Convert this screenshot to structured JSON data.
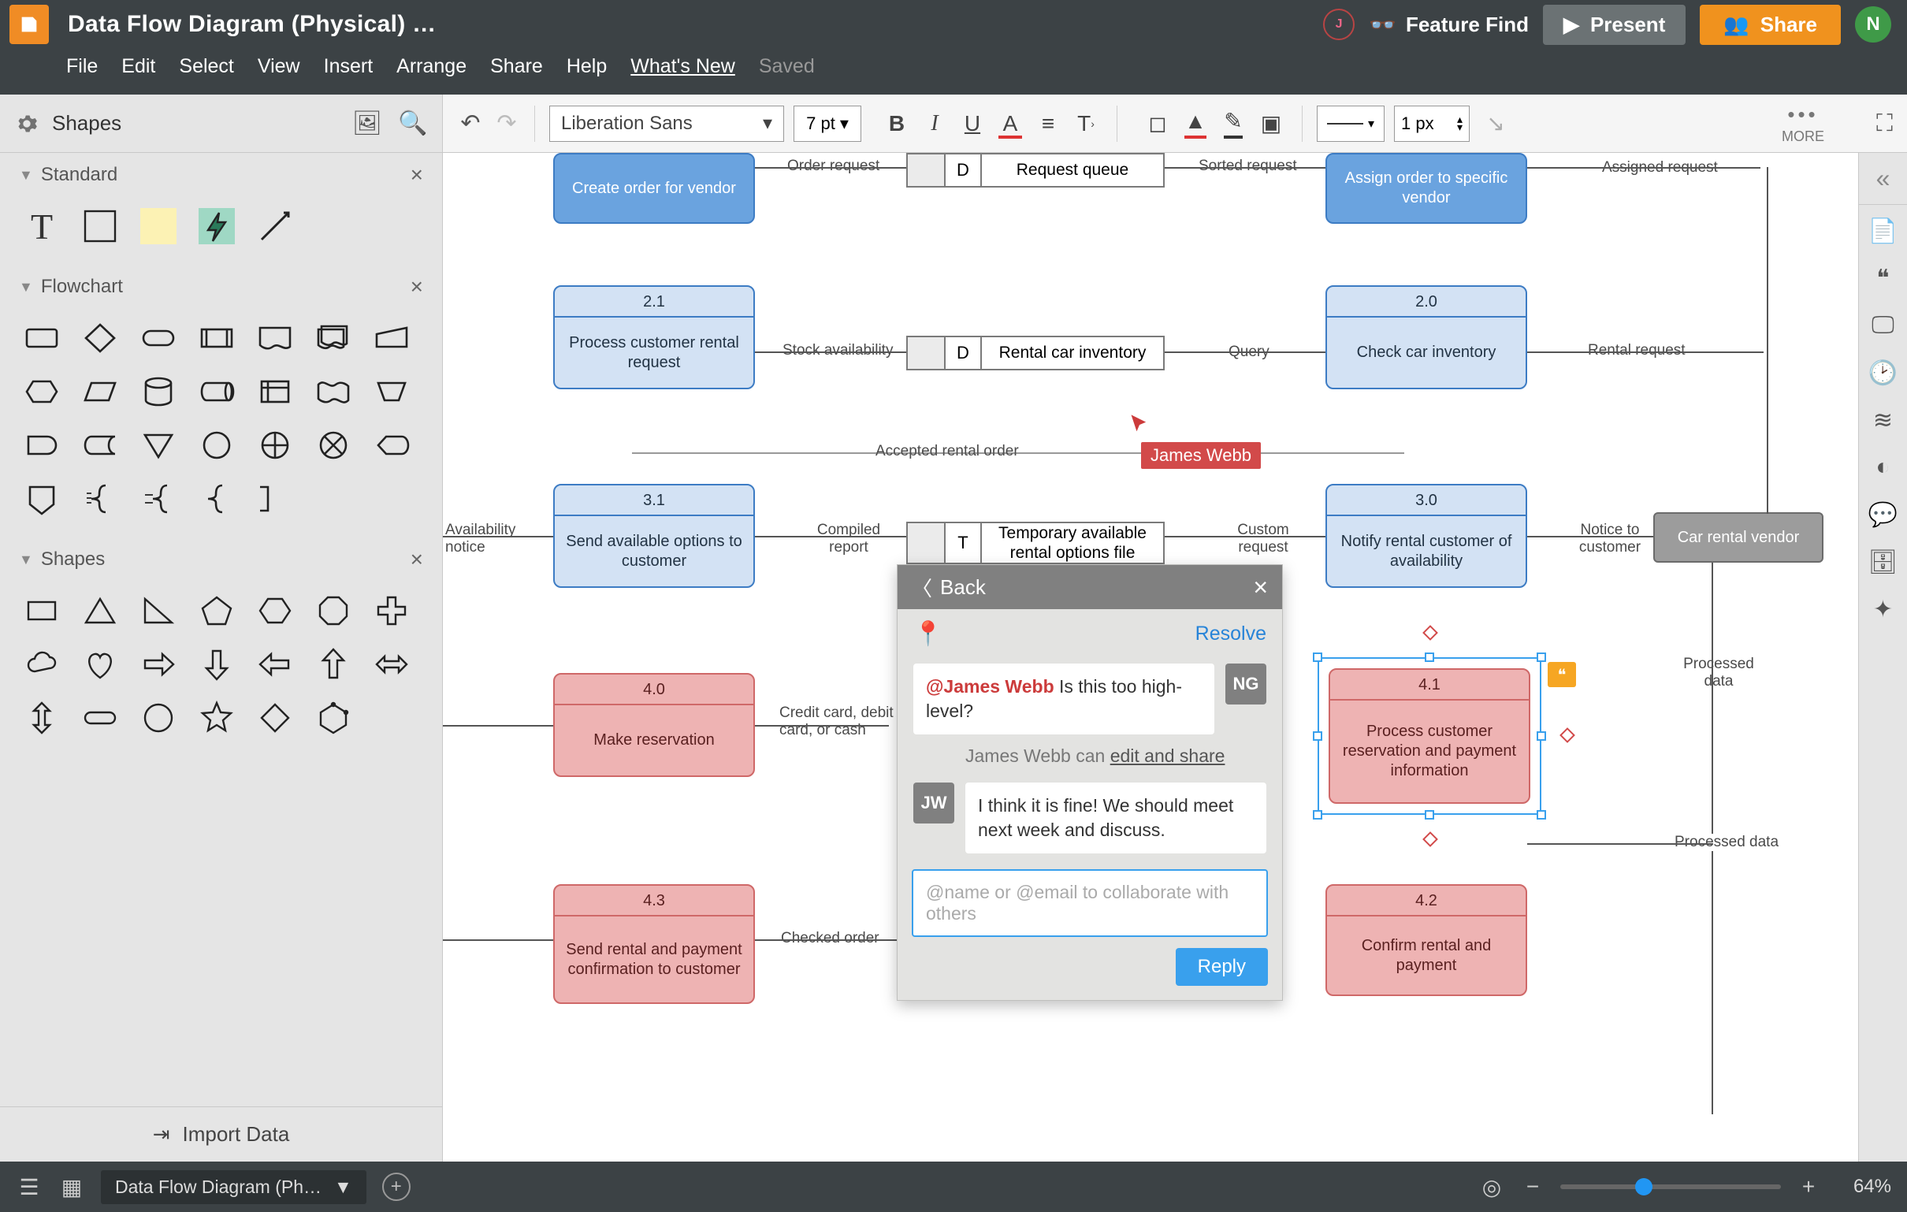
{
  "doc": {
    "title": "Data Flow Diagram (Physical) …"
  },
  "menu": {
    "file": "File",
    "edit": "Edit",
    "select": "Select",
    "view": "View",
    "insert": "Insert",
    "arrange": "Arrange",
    "share": "Share",
    "help": "Help",
    "whatsnew": "What's New",
    "saved": "Saved"
  },
  "topActions": {
    "avatarJ": "J",
    "featureFind": "Feature Find",
    "present": "Present",
    "share": "Share",
    "avatarN": "N"
  },
  "toolbar": {
    "shapes": "Shapes",
    "font": "Liberation Sans",
    "pt": "7 pt",
    "px": "1 px",
    "more": "MORE"
  },
  "palette": {
    "standard": "Standard",
    "flow": "Flowchart",
    "shapes": "Shapes",
    "import": "Import Data"
  },
  "nodes": {
    "createOrder": "Create order for vendor",
    "assignOrder": "Assign order to specific vendor",
    "p21": {
      "id": "2.1",
      "t": "Process customer rental request"
    },
    "p20": {
      "id": "2.0",
      "t": "Check car inventory"
    },
    "p31": {
      "id": "3.1",
      "t": "Send available options to customer"
    },
    "p30": {
      "id": "3.0",
      "t": "Notify rental customer of availability"
    },
    "p40": {
      "id": "4.0",
      "t": "Make reservation"
    },
    "p41": {
      "id": "4.1",
      "t": "Process customer reservation and payment information"
    },
    "p42": {
      "id": "4.2",
      "t": "Confirm rental and payment"
    },
    "p43": {
      "id": "4.3",
      "t": "Send rental and payment confirmation to customer"
    },
    "vendor": "Car rental vendor",
    "dsQueue": {
      "k": "D",
      "t": "Request queue"
    },
    "dsInv": {
      "k": "D",
      "t": "Rental car inventory"
    },
    "dsTemp": {
      "k": "T",
      "t": "Temporary available rental options file"
    }
  },
  "edges": {
    "orderReq": "Order request",
    "sortedReq": "Sorted request",
    "assignedReq": "Assigned request",
    "stockAvail": "Stock availability",
    "query": "Query",
    "rentalReq": "Rental request",
    "acceptedOrder": "Accepted rental order",
    "availNotice": "Availability notice",
    "compiled": "Compiled report",
    "customReq": "Custom request",
    "noticeCust": "Notice to customer",
    "credit": "Credit card, debit card, or cash",
    "checkedOrder": "Checked order",
    "processedData": "Processed data",
    "processedData2": "Processed data"
  },
  "cursor": {
    "name": "James Webb"
  },
  "comments": {
    "back": "Back",
    "resolve": "Resolve",
    "c1": {
      "av": "NG",
      "mention": "@James Webb",
      "text": " Is this too high-level?"
    },
    "perm": {
      "name": "James Webb",
      "can": " can ",
      "link": "edit and share"
    },
    "c2": {
      "av": "JW",
      "text": "I think it is fine! We should meet next week and discuss."
    },
    "placeholder": "@name or @email to collaborate with others",
    "reply": "Reply"
  },
  "status": {
    "page": "Data Flow Diagram (Ph…",
    "zoom": "64%"
  }
}
